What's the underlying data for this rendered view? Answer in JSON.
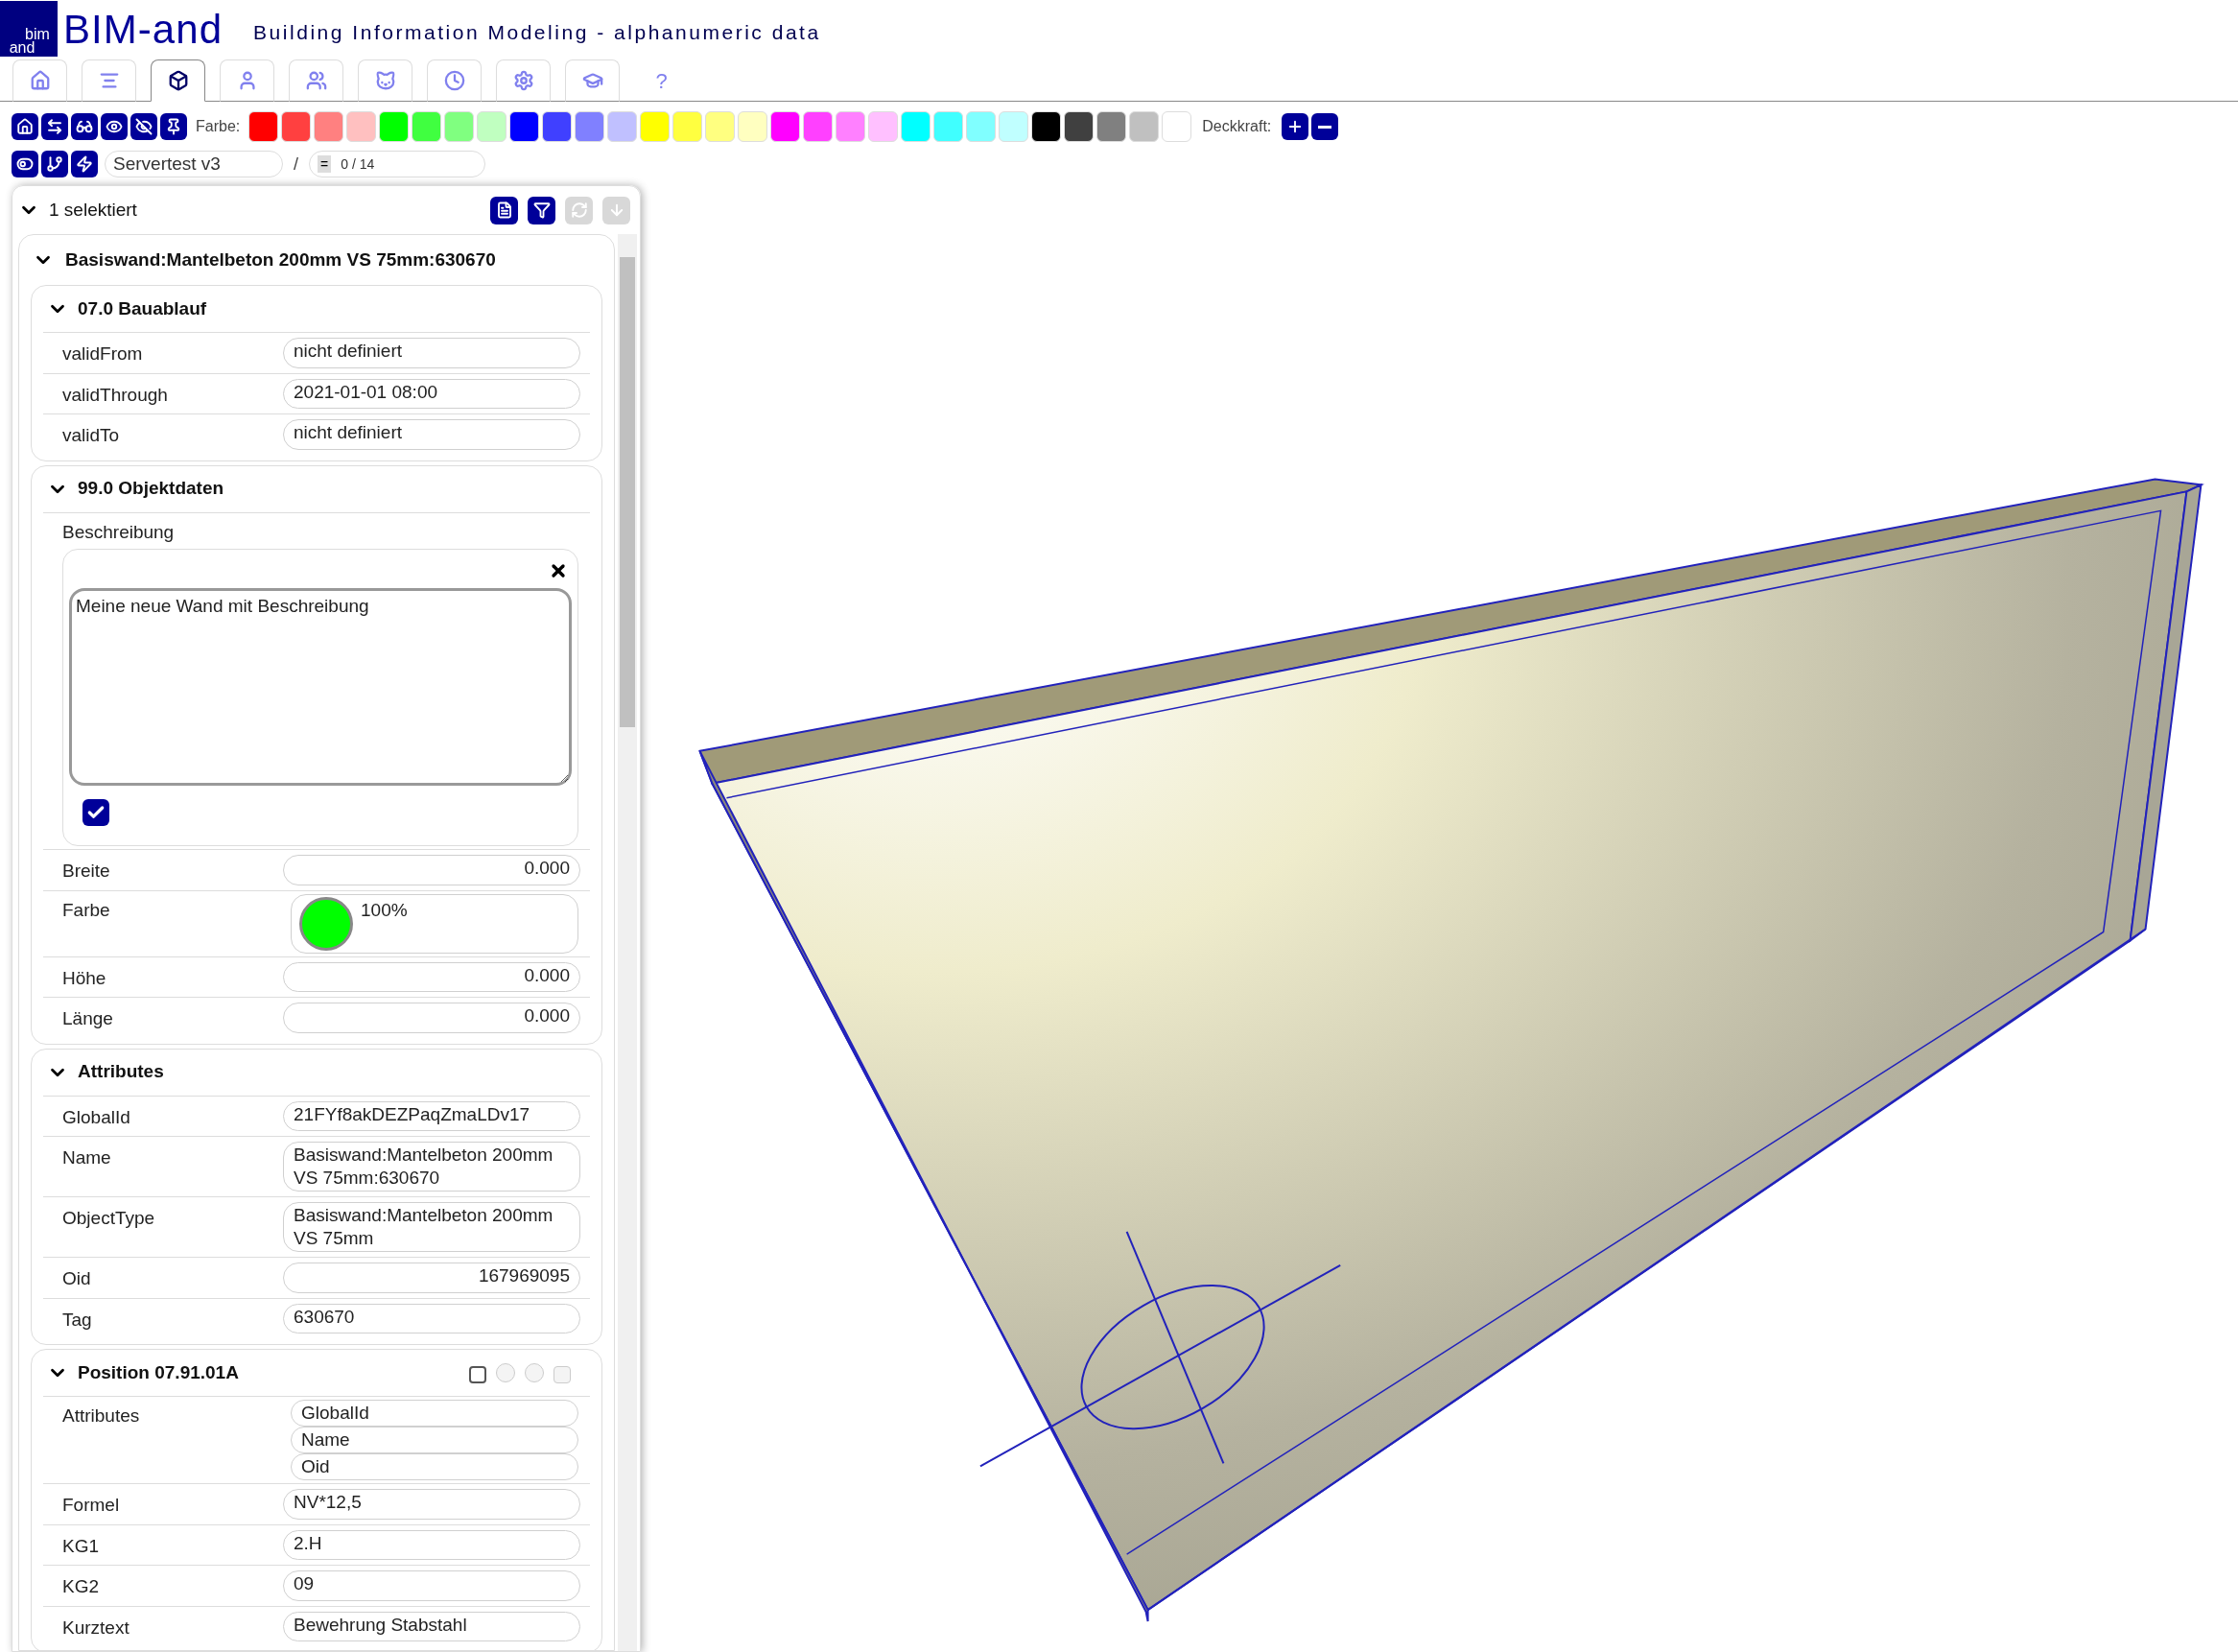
{
  "header": {
    "logo_top": "bim",
    "logo_bottom": "and",
    "brand": "BIM-and",
    "subtitle": "Building Information Modeling - alphanumeric data"
  },
  "tabs": [
    {
      "kind": "home",
      "selected": false
    },
    {
      "kind": "list",
      "selected": false
    },
    {
      "kind": "cube",
      "selected": true
    },
    {
      "kind": "user",
      "selected": false
    },
    {
      "kind": "users",
      "selected": false
    },
    {
      "kind": "cat",
      "selected": false
    },
    {
      "kind": "clock",
      "selected": false
    },
    {
      "kind": "gear",
      "selected": false
    },
    {
      "kind": "cap",
      "selected": false
    },
    {
      "kind": "text",
      "label": "?",
      "selected": false
    }
  ],
  "toolbar": {
    "tools": [
      {
        "kind": "home"
      },
      {
        "kind": "swap"
      },
      {
        "kind": "glasses"
      },
      {
        "kind": "eye"
      },
      {
        "kind": "eye-off"
      },
      {
        "kind": "pin"
      }
    ],
    "color_label": "Farbe:",
    "swatches": [
      {
        "color": "#ff0000"
      },
      {
        "color": "#ff4040"
      },
      {
        "color": "#ff8080"
      },
      {
        "color": "#ffc0c0"
      },
      {
        "color": "#00ff00"
      },
      {
        "color": "#40ff40"
      },
      {
        "color": "#80ff80"
      },
      {
        "color": "#c0ffc0"
      },
      {
        "color": "#0000ff"
      },
      {
        "color": "#4040ff"
      },
      {
        "color": "#8080ff"
      },
      {
        "color": "#c0c0ff"
      },
      {
        "color": "#ffff00"
      },
      {
        "color": "#ffff40"
      },
      {
        "color": "#ffff80"
      },
      {
        "color": "#ffffc0"
      },
      {
        "color": "#ff00ff"
      },
      {
        "color": "#ff40ff"
      },
      {
        "color": "#ff80ff"
      },
      {
        "color": "#ffc0ff"
      },
      {
        "color": "#00ffff"
      },
      {
        "color": "#40ffff"
      },
      {
        "color": "#80ffff"
      },
      {
        "color": "#c0ffff"
      },
      {
        "color": "#000000"
      },
      {
        "color": "#404040"
      },
      {
        "color": "#808080"
      },
      {
        "color": "#c0c0c0"
      },
      {
        "color": "#ffffff"
      }
    ],
    "opacity_label": "Deckkraft:",
    "opacity_buttons": [
      {
        "kind": "plus"
      },
      {
        "kind": "minus"
      }
    ]
  },
  "viewbar": {
    "tools": [
      {
        "kind": "toggle"
      },
      {
        "kind": "branch"
      },
      {
        "kind": "bolt"
      }
    ],
    "model": "Servertest v3",
    "separator": "/",
    "revision_icon": "=",
    "revision": "0 / 14"
  },
  "panel": {
    "title": "1 selektiert",
    "expanded": true,
    "actions": [
      {
        "kind": "file",
        "disabled": false
      },
      {
        "kind": "filter",
        "disabled": false
      },
      {
        "kind": "refresh",
        "disabled": true
      },
      {
        "kind": "download",
        "disabled": true
      }
    ],
    "object": {
      "title": "Basiswand:Mantelbeton 200mm VS 75mm:630670",
      "expanded": true,
      "sections": [
        {
          "title": "07.0 Bauablauf",
          "expanded": true,
          "rows": [
            {
              "kind": "text",
              "label": "validFrom",
              "value": "nicht definiert"
            },
            {
              "kind": "text",
              "label": "validThrough",
              "value": "2021-01-01 08:00"
            },
            {
              "kind": "text",
              "label": "validTo",
              "value": "nicht definiert"
            }
          ]
        },
        {
          "title": "99.0 Objektdaten",
          "expanded": true,
          "rows": [
            {
              "kind": "memo",
              "label": "Beschreibung",
              "value": "Meine neue Wand mit Beschreibung",
              "checked": true
            },
            {
              "kind": "number",
              "label": "Breite",
              "value": "0.000"
            },
            {
              "kind": "color",
              "label": "Farbe",
              "color": "#00ff00",
              "value": "100%"
            },
            {
              "kind": "number",
              "label": "Höhe",
              "value": "0.000"
            },
            {
              "kind": "number",
              "label": "Länge",
              "value": "0.000"
            }
          ]
        },
        {
          "title": "Attributes",
          "expanded": true,
          "rows": [
            {
              "kind": "text",
              "label": "GlobalId",
              "value": "21FYf8akDEZPaqZmaLDv17"
            },
            {
              "kind": "text",
              "label": "Name",
              "value": "Basiswand:Mantelbeton 200mm VS 75mm:630670"
            },
            {
              "kind": "text",
              "label": "ObjectType",
              "value": "Basiswand:Mantelbeton 200mm VS 75mm"
            },
            {
              "kind": "number",
              "label": "Oid",
              "value": "167969095"
            },
            {
              "kind": "text",
              "label": "Tag",
              "value": "630670"
            }
          ]
        },
        {
          "title": "Position 07.91.01A",
          "expanded": true,
          "controls": [
            {
              "kind": "checkbox",
              "checked": false,
              "disabled": false
            },
            {
              "kind": "radio",
              "checked": false,
              "disabled": true
            },
            {
              "kind": "radio",
              "checked": false,
              "disabled": true
            },
            {
              "kind": "checkbox",
              "checked": false,
              "disabled": true
            }
          ],
          "rows": [
            {
              "kind": "list",
              "label": "Attributes",
              "values": [
                "GlobalId",
                "Name",
                "Oid"
              ]
            },
            {
              "kind": "text",
              "label": "Formel",
              "value": "NV*12,5"
            },
            {
              "kind": "text",
              "label": "KG1",
              "value": "2.H"
            },
            {
              "kind": "text",
              "label": "KG2",
              "value": "09"
            },
            {
              "kind": "text",
              "label": "Kurztext",
              "value": "Bewehrung Stabstahl"
            }
          ]
        }
      ]
    }
  }
}
